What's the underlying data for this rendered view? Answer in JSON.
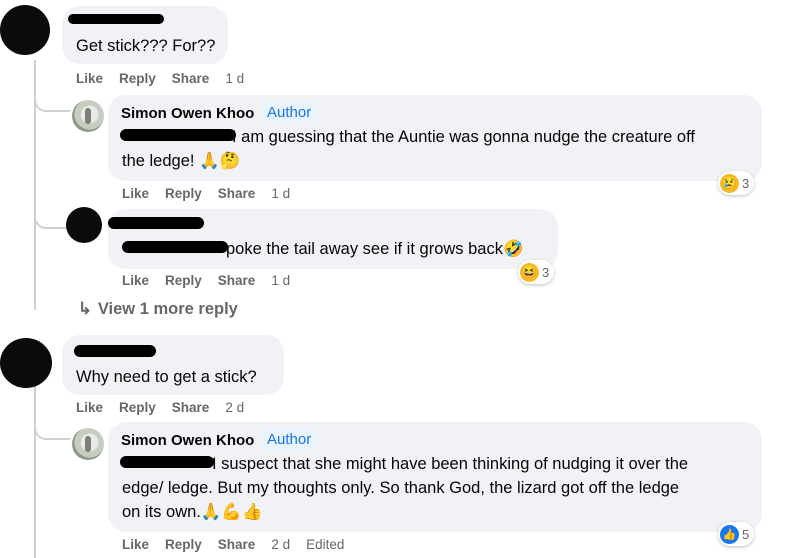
{
  "comments": [
    {
      "text": "Get stick??? For??",
      "actions": {
        "like": "Like",
        "reply": "Reply",
        "share": "Share",
        "time": "1 d"
      }
    },
    {
      "name": "Simon Owen Khoo",
      "badge": "Author",
      "text_line1": "I am guessing that the Auntie was gonna nudge the creature off",
      "text_line2": "the ledge! 🙏🤔",
      "reaction_count": "3",
      "reaction_icon": "sad-icon",
      "actions": {
        "like": "Like",
        "reply": "Reply",
        "share": "Share",
        "time": "1 d"
      }
    },
    {
      "text": "poke the tail away see if it grows back🤣",
      "reaction_count": "3",
      "reaction_icon": "haha-icon",
      "actions": {
        "like": "Like",
        "reply": "Reply",
        "share": "Share",
        "time": "1 d"
      }
    },
    {
      "view_more": "View 1 more reply"
    },
    {
      "text": "Why need to get a stick?",
      "actions": {
        "like": "Like",
        "reply": "Reply",
        "share": "Share",
        "time": "2 d"
      }
    },
    {
      "name": "Simon Owen Khoo",
      "badge": "Author",
      "text_line1": "I suspect that she might have been thinking of nudging it over the",
      "text_line2": "edge/ ledge. But my thoughts only. So thank God, the lizard got off the ledge",
      "text_line3": "on its own.🙏💪👍",
      "reaction_count": "5",
      "reaction_icon": "like-icon",
      "actions": {
        "like": "Like",
        "reply": "Reply",
        "share": "Share",
        "time": "2 d",
        "edited": "Edited"
      }
    }
  ],
  "colors": {
    "bubble": "#f0f2f5",
    "meta": "#65676b",
    "author_badge": "#1b74e4",
    "like_blue": "#1877f2"
  }
}
